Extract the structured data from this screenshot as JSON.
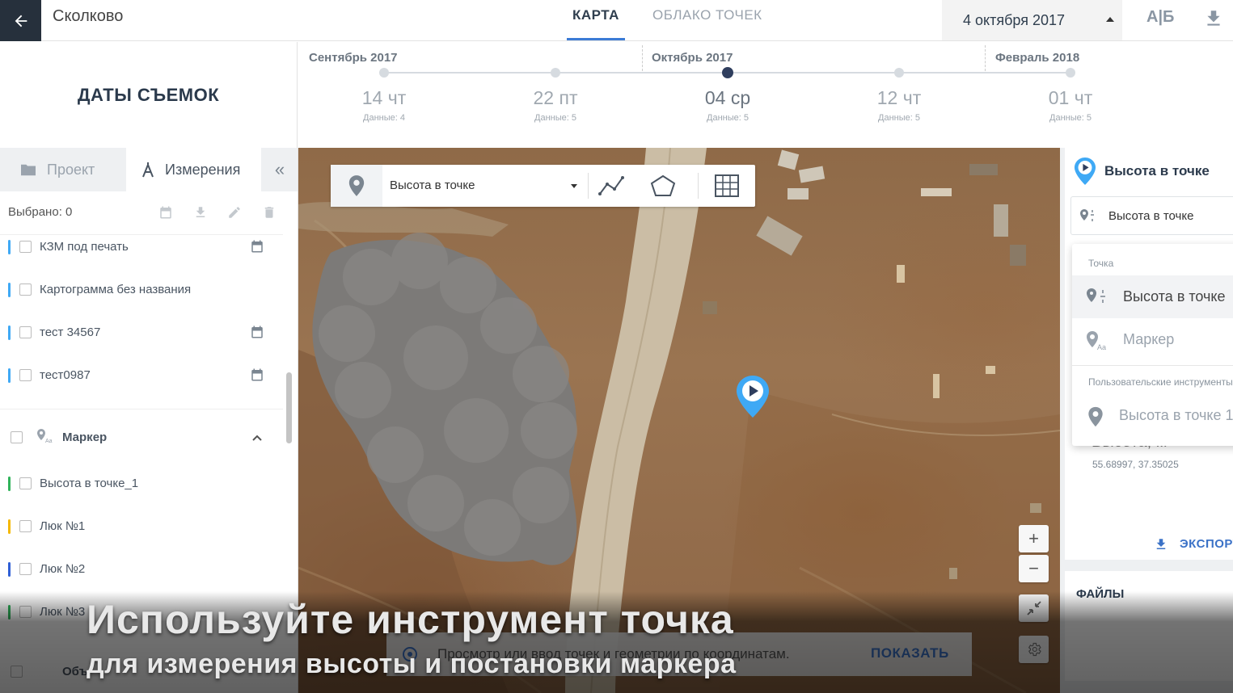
{
  "header": {
    "project_title": "Сколково",
    "tabs": [
      {
        "label": "КАРТА",
        "active": true
      },
      {
        "label": "ОБЛАКО ТОЧЕК",
        "active": false
      }
    ],
    "date_selected": "4 октября 2017",
    "ab_label": "А|Б"
  },
  "timeline": {
    "title": "ДАТЫ СЪЕМОК",
    "months": [
      "Сентябрь 2017",
      "Октябрь 2017",
      "Февраль 2018"
    ],
    "dates": [
      {
        "day": "14 чт",
        "data": "Данные: 4",
        "active": false
      },
      {
        "day": "22 пт",
        "data": "Данные: 5",
        "active": false
      },
      {
        "day": "04 ср",
        "data": "Данные: 5",
        "active": true
      },
      {
        "day": "12 чт",
        "data": "Данные: 5",
        "active": false
      },
      {
        "day": "01 чт",
        "data": "Данные: 5",
        "active": false
      }
    ]
  },
  "left_panel": {
    "tab_project": "Проект",
    "tab_measure": "Измерения",
    "selected_label": "Выбрано: 0",
    "items": [
      {
        "label": "КЗМ под печать",
        "color": "#3fa9f5",
        "calendar": true
      },
      {
        "label": "Картограмма без названия",
        "color": "#3fa9f5",
        "calendar": false
      },
      {
        "label": "тест 34567",
        "color": "#3fa9f5",
        "calendar": true
      },
      {
        "label": "тест0987",
        "color": "#3fa9f5",
        "calendar": true
      }
    ],
    "group": {
      "label": "Маркер"
    },
    "group_items": [
      {
        "label": "Высота в точке_1",
        "color": "#2fb35a"
      },
      {
        "label": "Люк №1",
        "color": "#f5b800"
      },
      {
        "label": "Люк №2",
        "color": "#2f5fd6"
      },
      {
        "label": "Люк №3",
        "color": "#2fb35a"
      }
    ],
    "partial_item": "Объ"
  },
  "map": {
    "tool_select": "Высота в точке",
    "coord_hint": "Просмотр или ввод точек и геометрии по координатам.",
    "show_label": "ПОКАЗАТЬ",
    "zoom_in": "+",
    "zoom_out": "−"
  },
  "right_panel": {
    "title": "Высота в точке",
    "input_value": "Высота в точке",
    "height_label": "Высота, м",
    "coords": "55.68997, 37.35025",
    "export_label": "ЭКСПОРТ",
    "files_label": "ФАЙЛЫ"
  },
  "dropdown": {
    "section_point": "Точка",
    "item_height": "Высота в точке",
    "item_marker": "Маркер",
    "section_custom": "Пользовательские инструменты",
    "item_custom": "Высота в точке 1"
  },
  "caption": {
    "line1": "Используйте инструмент точка",
    "line2": "для измерения высоты и постановки маркера"
  },
  "colors": {
    "accent": "#3b72c7",
    "dark_nav": "#26303c",
    "pin": "#3fa9f5"
  }
}
